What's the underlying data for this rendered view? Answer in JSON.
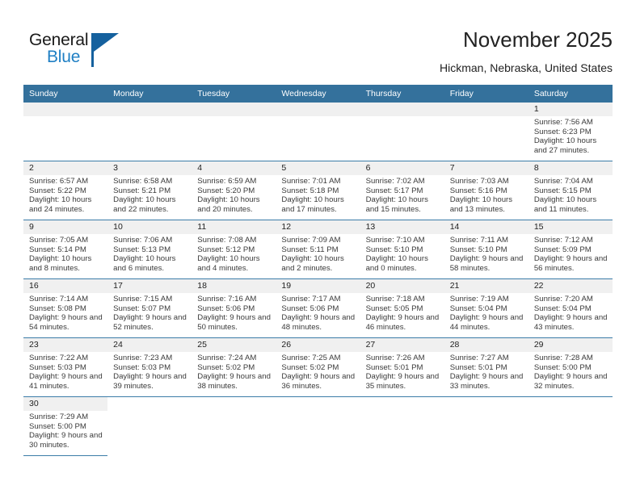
{
  "brand": {
    "name_top": "General",
    "name_bottom": "Blue",
    "accent_color": "#15619e",
    "blue_text_color": "#1f7fc4"
  },
  "header": {
    "title": "November 2025",
    "subtitle": "Hickman, Nebraska, United States"
  },
  "theme": {
    "header_bg": "#34719c",
    "daynum_bg": "#f0f0f0",
    "row_divider": "#3b7ca8"
  },
  "weekday_headers": [
    "Sunday",
    "Monday",
    "Tuesday",
    "Wednesday",
    "Thursday",
    "Friday",
    "Saturday"
  ],
  "labels": {
    "sunrise_prefix": "Sunrise:",
    "sunset_prefix": "Sunset:",
    "daylight_prefix": "Daylight:"
  },
  "weeks": [
    [
      {
        "day": "",
        "lines": []
      },
      {
        "day": "",
        "lines": []
      },
      {
        "day": "",
        "lines": []
      },
      {
        "day": "",
        "lines": []
      },
      {
        "day": "",
        "lines": []
      },
      {
        "day": "",
        "lines": []
      },
      {
        "day": "1",
        "lines": [
          "Sunrise: 7:56 AM",
          "Sunset: 6:23 PM",
          "Daylight: 10 hours and 27 minutes."
        ],
        "sunrise": "7:56 AM",
        "sunset": "6:23 PM",
        "daylight": "10 hours and 27 minutes."
      }
    ],
    [
      {
        "day": "2",
        "lines": [
          "Sunrise: 6:57 AM",
          "Sunset: 5:22 PM",
          "Daylight: 10 hours and 24 minutes."
        ],
        "sunrise": "6:57 AM",
        "sunset": "5:22 PM",
        "daylight": "10 hours and 24 minutes."
      },
      {
        "day": "3",
        "lines": [
          "Sunrise: 6:58 AM",
          "Sunset: 5:21 PM",
          "Daylight: 10 hours and 22 minutes."
        ],
        "sunrise": "6:58 AM",
        "sunset": "5:21 PM",
        "daylight": "10 hours and 22 minutes."
      },
      {
        "day": "4",
        "lines": [
          "Sunrise: 6:59 AM",
          "Sunset: 5:20 PM",
          "Daylight: 10 hours and 20 minutes."
        ],
        "sunrise": "6:59 AM",
        "sunset": "5:20 PM",
        "daylight": "10 hours and 20 minutes."
      },
      {
        "day": "5",
        "lines": [
          "Sunrise: 7:01 AM",
          "Sunset: 5:18 PM",
          "Daylight: 10 hours and 17 minutes."
        ],
        "sunrise": "7:01 AM",
        "sunset": "5:18 PM",
        "daylight": "10 hours and 17 minutes."
      },
      {
        "day": "6",
        "lines": [
          "Sunrise: 7:02 AM",
          "Sunset: 5:17 PM",
          "Daylight: 10 hours and 15 minutes."
        ],
        "sunrise": "7:02 AM",
        "sunset": "5:17 PM",
        "daylight": "10 hours and 15 minutes."
      },
      {
        "day": "7",
        "lines": [
          "Sunrise: 7:03 AM",
          "Sunset: 5:16 PM",
          "Daylight: 10 hours and 13 minutes."
        ],
        "sunrise": "7:03 AM",
        "sunset": "5:16 PM",
        "daylight": "10 hours and 13 minutes."
      },
      {
        "day": "8",
        "lines": [
          "Sunrise: 7:04 AM",
          "Sunset: 5:15 PM",
          "Daylight: 10 hours and 11 minutes."
        ],
        "sunrise": "7:04 AM",
        "sunset": "5:15 PM",
        "daylight": "10 hours and 11 minutes."
      }
    ],
    [
      {
        "day": "9",
        "lines": [
          "Sunrise: 7:05 AM",
          "Sunset: 5:14 PM",
          "Daylight: 10 hours and 8 minutes."
        ],
        "sunrise": "7:05 AM",
        "sunset": "5:14 PM",
        "daylight": "10 hours and 8 minutes."
      },
      {
        "day": "10",
        "lines": [
          "Sunrise: 7:06 AM",
          "Sunset: 5:13 PM",
          "Daylight: 10 hours and 6 minutes."
        ],
        "sunrise": "7:06 AM",
        "sunset": "5:13 PM",
        "daylight": "10 hours and 6 minutes."
      },
      {
        "day": "11",
        "lines": [
          "Sunrise: 7:08 AM",
          "Sunset: 5:12 PM",
          "Daylight: 10 hours and 4 minutes."
        ],
        "sunrise": "7:08 AM",
        "sunset": "5:12 PM",
        "daylight": "10 hours and 4 minutes."
      },
      {
        "day": "12",
        "lines": [
          "Sunrise: 7:09 AM",
          "Sunset: 5:11 PM",
          "Daylight: 10 hours and 2 minutes."
        ],
        "sunrise": "7:09 AM",
        "sunset": "5:11 PM",
        "daylight": "10 hours and 2 minutes."
      },
      {
        "day": "13",
        "lines": [
          "Sunrise: 7:10 AM",
          "Sunset: 5:10 PM",
          "Daylight: 10 hours and 0 minutes."
        ],
        "sunrise": "7:10 AM",
        "sunset": "5:10 PM",
        "daylight": "10 hours and 0 minutes."
      },
      {
        "day": "14",
        "lines": [
          "Sunrise: 7:11 AM",
          "Sunset: 5:10 PM",
          "Daylight: 9 hours and 58 minutes."
        ],
        "sunrise": "7:11 AM",
        "sunset": "5:10 PM",
        "daylight": "9 hours and 58 minutes."
      },
      {
        "day": "15",
        "lines": [
          "Sunrise: 7:12 AM",
          "Sunset: 5:09 PM",
          "Daylight: 9 hours and 56 minutes."
        ],
        "sunrise": "7:12 AM",
        "sunset": "5:09 PM",
        "daylight": "9 hours and 56 minutes."
      }
    ],
    [
      {
        "day": "16",
        "lines": [
          "Sunrise: 7:14 AM",
          "Sunset: 5:08 PM",
          "Daylight: 9 hours and 54 minutes."
        ],
        "sunrise": "7:14 AM",
        "sunset": "5:08 PM",
        "daylight": "9 hours and 54 minutes."
      },
      {
        "day": "17",
        "lines": [
          "Sunrise: 7:15 AM",
          "Sunset: 5:07 PM",
          "Daylight: 9 hours and 52 minutes."
        ],
        "sunrise": "7:15 AM",
        "sunset": "5:07 PM",
        "daylight": "9 hours and 52 minutes."
      },
      {
        "day": "18",
        "lines": [
          "Sunrise: 7:16 AM",
          "Sunset: 5:06 PM",
          "Daylight: 9 hours and 50 minutes."
        ],
        "sunrise": "7:16 AM",
        "sunset": "5:06 PM",
        "daylight": "9 hours and 50 minutes."
      },
      {
        "day": "19",
        "lines": [
          "Sunrise: 7:17 AM",
          "Sunset: 5:06 PM",
          "Daylight: 9 hours and 48 minutes."
        ],
        "sunrise": "7:17 AM",
        "sunset": "5:06 PM",
        "daylight": "9 hours and 48 minutes."
      },
      {
        "day": "20",
        "lines": [
          "Sunrise: 7:18 AM",
          "Sunset: 5:05 PM",
          "Daylight: 9 hours and 46 minutes."
        ],
        "sunrise": "7:18 AM",
        "sunset": "5:05 PM",
        "daylight": "9 hours and 46 minutes."
      },
      {
        "day": "21",
        "lines": [
          "Sunrise: 7:19 AM",
          "Sunset: 5:04 PM",
          "Daylight: 9 hours and 44 minutes."
        ],
        "sunrise": "7:19 AM",
        "sunset": "5:04 PM",
        "daylight": "9 hours and 44 minutes."
      },
      {
        "day": "22",
        "lines": [
          "Sunrise: 7:20 AM",
          "Sunset: 5:04 PM",
          "Daylight: 9 hours and 43 minutes."
        ],
        "sunrise": "7:20 AM",
        "sunset": "5:04 PM",
        "daylight": "9 hours and 43 minutes."
      }
    ],
    [
      {
        "day": "23",
        "lines": [
          "Sunrise: 7:22 AM",
          "Sunset: 5:03 PM",
          "Daylight: 9 hours and 41 minutes."
        ],
        "sunrise": "7:22 AM",
        "sunset": "5:03 PM",
        "daylight": "9 hours and 41 minutes."
      },
      {
        "day": "24",
        "lines": [
          "Sunrise: 7:23 AM",
          "Sunset: 5:03 PM",
          "Daylight: 9 hours and 39 minutes."
        ],
        "sunrise": "7:23 AM",
        "sunset": "5:03 PM",
        "daylight": "9 hours and 39 minutes."
      },
      {
        "day": "25",
        "lines": [
          "Sunrise: 7:24 AM",
          "Sunset: 5:02 PM",
          "Daylight: 9 hours and 38 minutes."
        ],
        "sunrise": "7:24 AM",
        "sunset": "5:02 PM",
        "daylight": "9 hours and 38 minutes."
      },
      {
        "day": "26",
        "lines": [
          "Sunrise: 7:25 AM",
          "Sunset: 5:02 PM",
          "Daylight: 9 hours and 36 minutes."
        ],
        "sunrise": "7:25 AM",
        "sunset": "5:02 PM",
        "daylight": "9 hours and 36 minutes."
      },
      {
        "day": "27",
        "lines": [
          "Sunrise: 7:26 AM",
          "Sunset: 5:01 PM",
          "Daylight: 9 hours and 35 minutes."
        ],
        "sunrise": "7:26 AM",
        "sunset": "5:01 PM",
        "daylight": "9 hours and 35 minutes."
      },
      {
        "day": "28",
        "lines": [
          "Sunrise: 7:27 AM",
          "Sunset: 5:01 PM",
          "Daylight: 9 hours and 33 minutes."
        ],
        "sunrise": "7:27 AM",
        "sunset": "5:01 PM",
        "daylight": "9 hours and 33 minutes."
      },
      {
        "day": "29",
        "lines": [
          "Sunrise: 7:28 AM",
          "Sunset: 5:00 PM",
          "Daylight: 9 hours and 32 minutes."
        ],
        "sunrise": "7:28 AM",
        "sunset": "5:00 PM",
        "daylight": "9 hours and 32 minutes."
      }
    ],
    [
      {
        "day": "30",
        "lines": [
          "Sunrise: 7:29 AM",
          "Sunset: 5:00 PM",
          "Daylight: 9 hours and 30 minutes."
        ],
        "sunrise": "7:29 AM",
        "sunset": "5:00 PM",
        "daylight": "9 hours and 30 minutes."
      },
      {
        "day": "",
        "lines": []
      },
      {
        "day": "",
        "lines": []
      },
      {
        "day": "",
        "lines": []
      },
      {
        "day": "",
        "lines": []
      },
      {
        "day": "",
        "lines": []
      },
      {
        "day": "",
        "lines": []
      }
    ]
  ]
}
